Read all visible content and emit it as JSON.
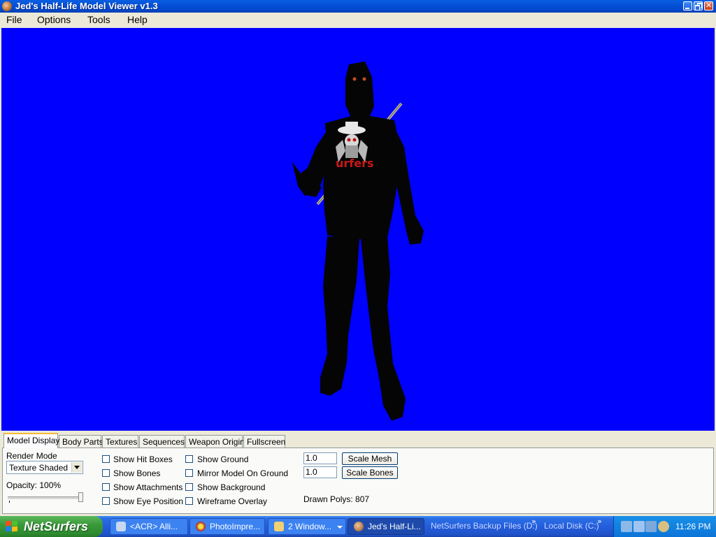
{
  "window": {
    "title": "Jed's Half-Life Model Viewer v1.3"
  },
  "menu": [
    "File",
    "Options",
    "Tools",
    "Help"
  ],
  "viewport": {
    "background_color": "#0000ff",
    "model_logo_text": "urfers"
  },
  "tabs": [
    "Model Display",
    "Body Parts",
    "Textures",
    "Sequences",
    "Weapon Origin",
    "Fullscreen"
  ],
  "model_display": {
    "render_mode_label": "Render Mode",
    "render_mode_value": "Texture Shaded",
    "opacity_label": "Opacity: 100%",
    "opacity_value": 1.0,
    "checkboxes_col1": [
      "Show Hit Boxes",
      "Show Bones",
      "Show Attachments",
      "Show Eye Position"
    ],
    "checkboxes_col2": [
      "Show Ground",
      "Mirror Model On Ground",
      "Show Background",
      "Wireframe Overlay"
    ],
    "scale_mesh_value": "1.0",
    "scale_bones_value": "1.0",
    "scale_mesh_button": "Scale Mesh",
    "scale_bones_button": "Scale Bones",
    "drawn_polys": "Drawn Polys: 807"
  },
  "taskbar": {
    "start_label": "NetSurfers",
    "tasks": [
      "<ACR> Alli...",
      "PhotoImpre...",
      "2 Window...",
      "Jed's Half-Li..."
    ],
    "toolbars": [
      "NetSurfers Backup Files (D:)",
      "Local Disk (C:)"
    ],
    "clock": "11:26 PM"
  }
}
